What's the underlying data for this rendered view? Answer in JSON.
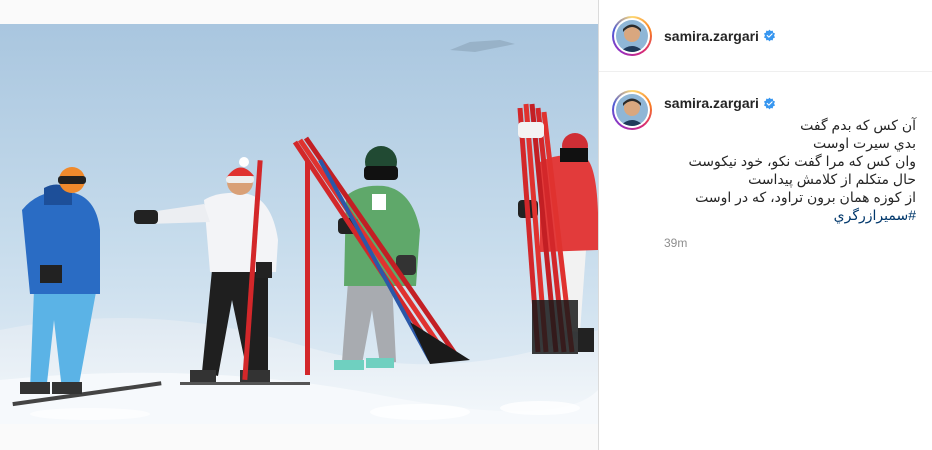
{
  "post": {
    "author": "samira.zargari",
    "verified": true
  },
  "caption": {
    "author": "samira.zargari",
    "lines": [
      "آن کس که بدم گفت",
      "بدي سيرت اوست",
      "وان کس که مرا گفت نکو، خود نیکوست",
      "حال متکلم از کلامش پیداست",
      "از کوزه همان برون تراود، که در اوست"
    ],
    "hashtag": "#سمیرازرگري",
    "time": "39m"
  },
  "colors": {
    "verified_badge": "#3897f0",
    "hashtag": "#00376b",
    "timestamp": "#8e8e8e"
  },
  "photo": {
    "subject": "skiers on a snowy slope carrying red slalom poles"
  }
}
